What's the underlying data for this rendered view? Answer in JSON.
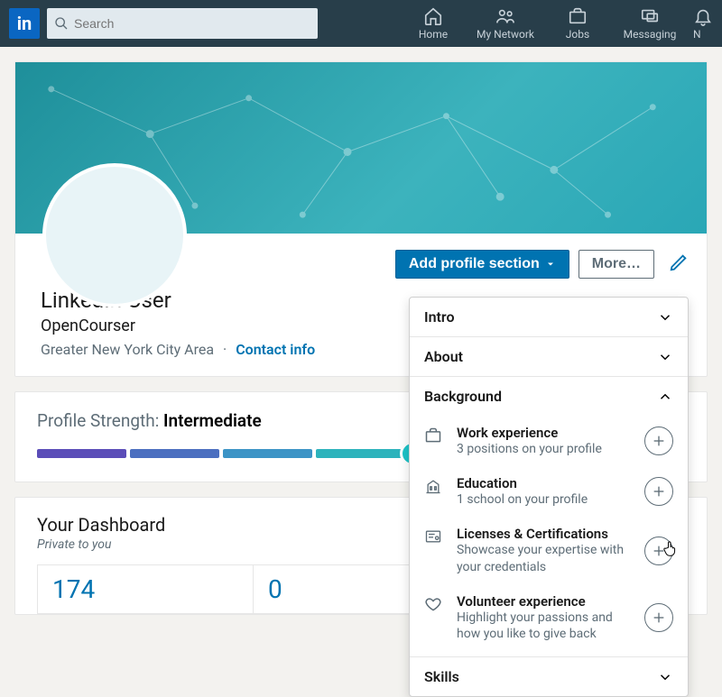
{
  "nav": {
    "search_placeholder": "Search",
    "items": [
      {
        "label": "Home"
      },
      {
        "label": "My Network"
      },
      {
        "label": "Jobs"
      },
      {
        "label": "Messaging"
      },
      {
        "label": "N"
      }
    ]
  },
  "profile": {
    "add_section_label": "Add profile section",
    "more_label": "More…",
    "name": "LinkedIn User",
    "headline": "OpenCourser",
    "location": "Greater New York City Area",
    "contact_info_label": "Contact info"
  },
  "dropdown": {
    "sections": [
      {
        "title": "Intro"
      },
      {
        "title": "About"
      },
      {
        "title": "Background"
      },
      {
        "title": "Skills"
      }
    ],
    "background_items": [
      {
        "title": "Work experience",
        "desc": "3 positions on your profile"
      },
      {
        "title": "Education",
        "desc": "1 school on your profile"
      },
      {
        "title": "Licenses & Certifications",
        "desc": "Showcase your expertise with your credentials"
      },
      {
        "title": "Volunteer experience",
        "desc": "Highlight your passions and how you like to give back"
      }
    ]
  },
  "strength": {
    "prefix": "Profile Strength: ",
    "level": "Intermediate"
  },
  "dashboard": {
    "title": "Your Dashboard",
    "subtitle": "Private to you",
    "stats": [
      {
        "value": "174"
      },
      {
        "value": "0"
      }
    ]
  }
}
